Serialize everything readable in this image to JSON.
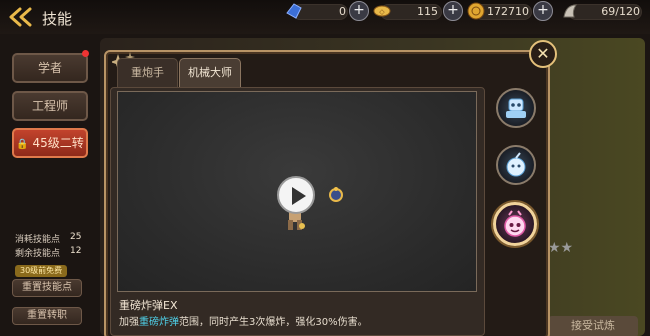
{
  "header": {
    "title": "技能",
    "resources": [
      {
        "name": "blue-gem",
        "value": "0"
      },
      {
        "name": "gold-coin-alt",
        "value": "115"
      },
      {
        "name": "gold-coin",
        "value": "172710"
      },
      {
        "name": "stamina",
        "value": "69/120"
      }
    ]
  },
  "sidebar": {
    "items": [
      {
        "label": "学者"
      },
      {
        "label": "工程师"
      },
      {
        "label": "45级二转"
      }
    ],
    "stats": [
      {
        "label": "消耗技能点",
        "value": "25"
      },
      {
        "label": "剩余技能点",
        "value": "12"
      }
    ],
    "free_badge": "30级前免费",
    "reset_button": "重置技能点",
    "reset_job_button": "重置转职"
  },
  "dialog": {
    "tabs": [
      {
        "label": "重炮手",
        "active": false
      },
      {
        "label": "机械大师",
        "active": true
      }
    ],
    "skill_name": "重磅炸弹EX",
    "skill_desc_prefix": "加强",
    "skill_desc_highlight": "重磅炸弹",
    "skill_desc_suffix": "范围，同时产生3次爆炸，强化30%伤害。",
    "close_label": "✕"
  },
  "background": {
    "button_label": "接受试炼"
  },
  "colors": {
    "accent_gold": "#e4c07a",
    "active_red": "#c2432c",
    "highlight_cyan": "#4fd0e8"
  }
}
